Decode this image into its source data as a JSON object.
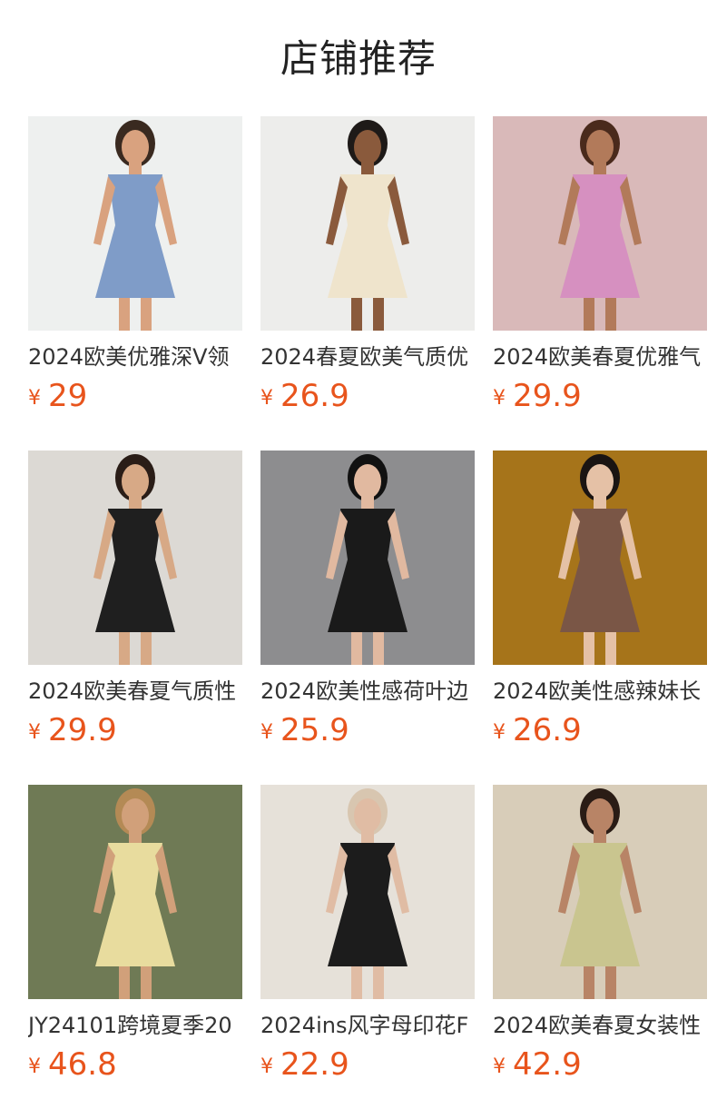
{
  "section": {
    "title": "店铺推荐"
  },
  "products": [
    {
      "name": "2024欧美优雅深V领",
      "currency": "¥",
      "price": "29",
      "colors": {
        "bg": "#eef0ef",
        "dress": "#7f9cc8",
        "skin": "#d9a27f",
        "hair": "#3a2a20"
      }
    },
    {
      "name": "2024春夏欧美气质优",
      "currency": "¥",
      "price": "26.9",
      "colors": {
        "bg": "#ededeb",
        "dress": "#efe4cc",
        "skin": "#8a5a3c",
        "hair": "#1e1a18"
      }
    },
    {
      "name": "2024欧美春夏优雅气",
      "currency": "¥",
      "price": "29.9",
      "colors": {
        "bg": "#d9b9b9",
        "dress": "#d690c0",
        "skin": "#b27a5a",
        "hair": "#4a2a1c"
      }
    },
    {
      "name": "2024欧美春夏气质性",
      "currency": "¥",
      "price": "29.9",
      "colors": {
        "bg": "#dcd9d4",
        "dress": "#1f1f1f",
        "skin": "#d7a986",
        "hair": "#2a1d17"
      }
    },
    {
      "name": "2024欧美性感荷叶边",
      "currency": "¥",
      "price": "25.9",
      "colors": {
        "bg": "#8d8d8f",
        "dress": "#1a1a1a",
        "skin": "#e1b9a0",
        "hair": "#111111"
      }
    },
    {
      "name": "2024欧美性感辣妹长",
      "currency": "¥",
      "price": "26.9",
      "colors": {
        "bg": "#a6741a",
        "dress": "#7a5646",
        "skin": "#e5c1a6",
        "hair": "#1a1412"
      }
    },
    {
      "name": "JY24101跨境夏季20",
      "currency": "¥",
      "price": "46.8",
      "colors": {
        "bg": "#6f7a55",
        "dress": "#e8dc9e",
        "skin": "#d1a07a",
        "hair": "#b48a55"
      }
    },
    {
      "name": "2024ins风字母印花F",
      "currency": "¥",
      "price": "22.9",
      "colors": {
        "bg": "#e6e1d9",
        "dress": "#1c1c1c",
        "skin": "#e0bca4",
        "hair": "#d8c6b0"
      }
    },
    {
      "name": "2024欧美春夏女装性",
      "currency": "¥",
      "price": "42.9",
      "colors": {
        "bg": "#d8cdb9",
        "dress": "#c9c58f",
        "skin": "#b88466",
        "hair": "#2a1c15"
      }
    }
  ]
}
